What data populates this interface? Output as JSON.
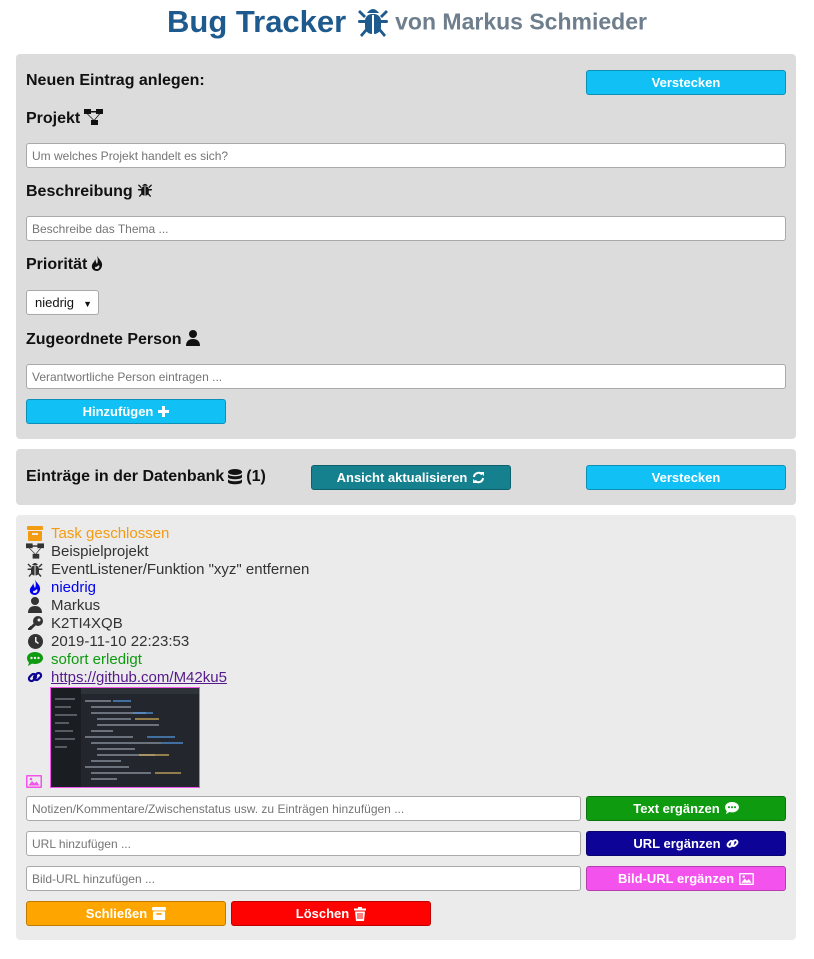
{
  "header": {
    "title": "Bug Tracker",
    "subtitle": "von Markus Schmieder",
    "icon": "bug-icon",
    "title_color": "#1f5a8e",
    "subtitle_color": "#6e7e8c"
  },
  "new_entry": {
    "heading": "Neuen Eintrag anlegen:",
    "hide_label": "Verstecken",
    "project_label": "Projekt",
    "project_icon": "sitemap-icon",
    "project_placeholder": "Um welches Projekt handelt es sich?",
    "description_label": "Beschreibung",
    "description_icon": "bug-icon",
    "description_placeholder": "Beschreibe das Thema ...",
    "priority_label": "Priorität",
    "priority_icon": "fire-icon",
    "priority_value": "niedrig",
    "person_label": "Zugeordnete Person",
    "person_icon": "user-icon",
    "person_placeholder": "Verantwortliche Person eintragen ...",
    "add_label": "Hinzufügen",
    "add_icon": "plus-icon"
  },
  "database": {
    "heading": "Einträge in der Datenbank",
    "heading_icon": "database-icon",
    "count": "(1)",
    "refresh_label": "Ansicht aktualisieren",
    "refresh_icon": "sync-icon",
    "hide_label": "Verstecken"
  },
  "entry": {
    "status": "Task geschlossen",
    "project": "Beispielprojekt",
    "description": "EventListener/Funktion \"xyz\" entfernen",
    "priority": "niedrig",
    "person": "Markus",
    "key": "K2TI4XQB",
    "timestamp": "2019-11-10 22:23:53",
    "comment": "sofort erledigt",
    "url": "https://github.com/M42ku5",
    "colors": {
      "status": "#f39c12",
      "priority": "#0000ee",
      "comment": "#0e9b10",
      "image_icon": "#f352ed"
    },
    "note_placeholder": "Notizen/Kommentare/Zwischenstatus usw. zu Einträgen hinzufügen ...",
    "text_button": "Text ergänzen",
    "url_placeholder": "URL hinzufügen ...",
    "url_button": "URL ergänzen",
    "image_url_placeholder": "Bild-URL hinzufügen ...",
    "image_url_button": "Bild-URL ergänzen",
    "close_button": "Schließen",
    "delete_button": "Löschen"
  }
}
